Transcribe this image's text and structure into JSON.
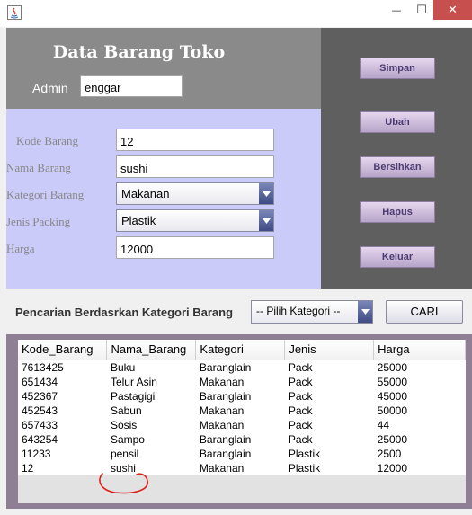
{
  "window": {
    "minimize_glyph": "—",
    "maximize_glyph": "☐",
    "close_glyph": "✕",
    "close_color": "#c7504e"
  },
  "header": {
    "title": "Data Barang Toko",
    "admin_label": "Admin",
    "admin_value": "enggar"
  },
  "form": {
    "kode_label": "Kode Barang",
    "kode_value": "12",
    "nama_label": "Nama Barang",
    "nama_value": "sushi",
    "kategori_label": "Kategori Barang",
    "kategori_value": "Makanan",
    "packing_label": "Jenis Packing",
    "packing_value": "Plastik",
    "harga_label": "Harga",
    "harga_value": "12000"
  },
  "actions": {
    "simpan": "Simpan",
    "ubah": "Ubah",
    "bersihkan": "Bersihkan",
    "hapus": "Hapus",
    "keluar": "Keluar"
  },
  "search": {
    "label": "Pencarian Berdasrkan Kategori Barang",
    "selected": "-- Pilih Kategori --",
    "button": "CARI"
  },
  "table": {
    "columns": [
      "Kode_Barang",
      "Nama_Barang",
      "Kategori",
      "Jenis",
      "Harga"
    ],
    "rows": [
      [
        "7613425",
        "Buku",
        "Baranglain",
        "Pack",
        "25000"
      ],
      [
        "651434",
        "Telur Asin",
        "Makanan",
        "Pack",
        "55000"
      ],
      [
        "452367",
        "Pastagigi",
        "Baranglain",
        "Pack",
        "45000"
      ],
      [
        "452543",
        "Sabun",
        "Makanan",
        "Pack",
        "50000"
      ],
      [
        "657433",
        "Sosis",
        "Makanan",
        "Pack",
        "44"
      ],
      [
        "643254",
        "Sampo",
        "Baranglain",
        "Pack",
        "25000"
      ],
      [
        "11233",
        "pensil",
        "Baranglain",
        "Plastik",
        "2500"
      ],
      [
        "12",
        "sushi",
        "Makanan",
        "Plastik",
        "12000"
      ]
    ]
  },
  "colors": {
    "header_bg": "#8a8a8a",
    "form_bg": "#cbcbfa",
    "right_panel_bg": "#5f5f5f",
    "table_panel_bg": "#8e7f94",
    "button_text": "#4b3c72",
    "annotation_red": "#e0201a"
  }
}
